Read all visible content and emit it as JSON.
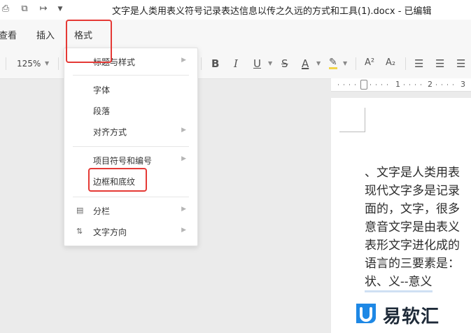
{
  "window": {
    "title": "文字是人类用表义符号记录表达信息以传之久远的方式和工具(1).docx - 已编辑",
    "quick_icons": [
      "printer-icon",
      "export-icon",
      "share-icon",
      "dropdown-icon"
    ]
  },
  "menu": {
    "tabs": [
      "查看",
      "插入",
      "格式"
    ]
  },
  "toolbar": {
    "zoom": "125%",
    "bold": "B",
    "italic": "I",
    "underline": "U",
    "strike": "S",
    "font_color": "A",
    "superscript": "A²",
    "subscript": "A₂"
  },
  "ruler": {
    "marks": [
      "1",
      "2",
      "3"
    ]
  },
  "format_menu": {
    "items": [
      {
        "label": "标题与样式",
        "has_submenu": true
      },
      {
        "label": "字体",
        "has_submenu": false
      },
      {
        "label": "段落",
        "has_submenu": false
      },
      {
        "label": "对齐方式",
        "has_submenu": true
      },
      {
        "label": "项目符号和编号",
        "has_submenu": true
      },
      {
        "label": "边框和底纹",
        "has_submenu": false
      },
      {
        "label": "分栏",
        "has_submenu": true,
        "icon": "columns-icon"
      },
      {
        "label": "文字方向",
        "has_submenu": true,
        "icon": "text-direction-icon"
      }
    ]
  },
  "document": {
    "lines": [
      "、文字是人类用表",
      "现代文字多是记录",
      "面的，文字，很多",
      "意音文字是由表义",
      "表形文字进化成的",
      "语言的三要素是：",
      "状、义--意义"
    ]
  },
  "watermark": {
    "text": "易软汇"
  },
  "colors": {
    "highlight_red": "#e53935",
    "accent_blue": "#1e88e5"
  }
}
